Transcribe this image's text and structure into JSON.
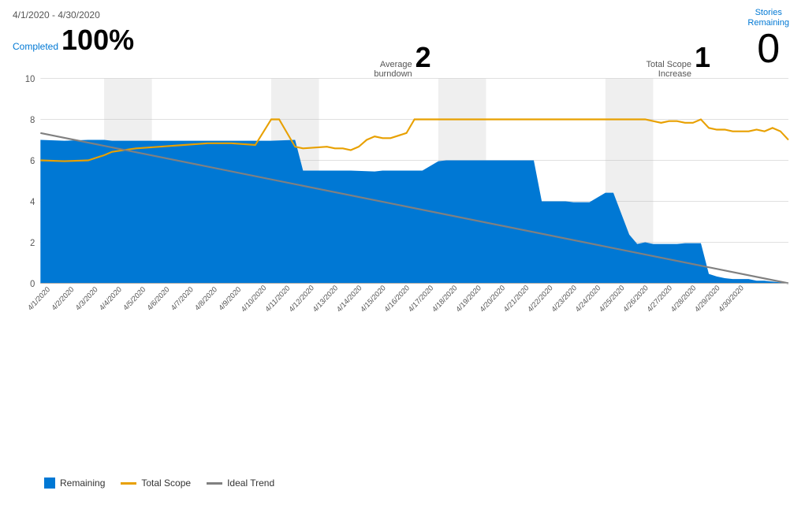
{
  "header": {
    "date_range": "4/1/2020 - 4/30/2020",
    "stories_remaining_label": "Stories\nRemaining",
    "stories_remaining_value": "0"
  },
  "stats": {
    "completed_label": "Completed",
    "completed_value": "100%",
    "avg_burndown_label": "Average\nburndown",
    "avg_burndown_value": "2",
    "total_scope_label": "Total Scope\nIncrease",
    "total_scope_value": "1"
  },
  "legend": {
    "remaining_label": "Remaining",
    "total_scope_label": "Total Scope",
    "ideal_trend_label": "Ideal Trend"
  },
  "colors": {
    "remaining_fill": "#0078d4",
    "total_scope_line": "#e8a000",
    "ideal_trend_line": "#808080",
    "axis": "#ccc",
    "weekend_bg": "rgba(180,180,180,0.25)"
  }
}
